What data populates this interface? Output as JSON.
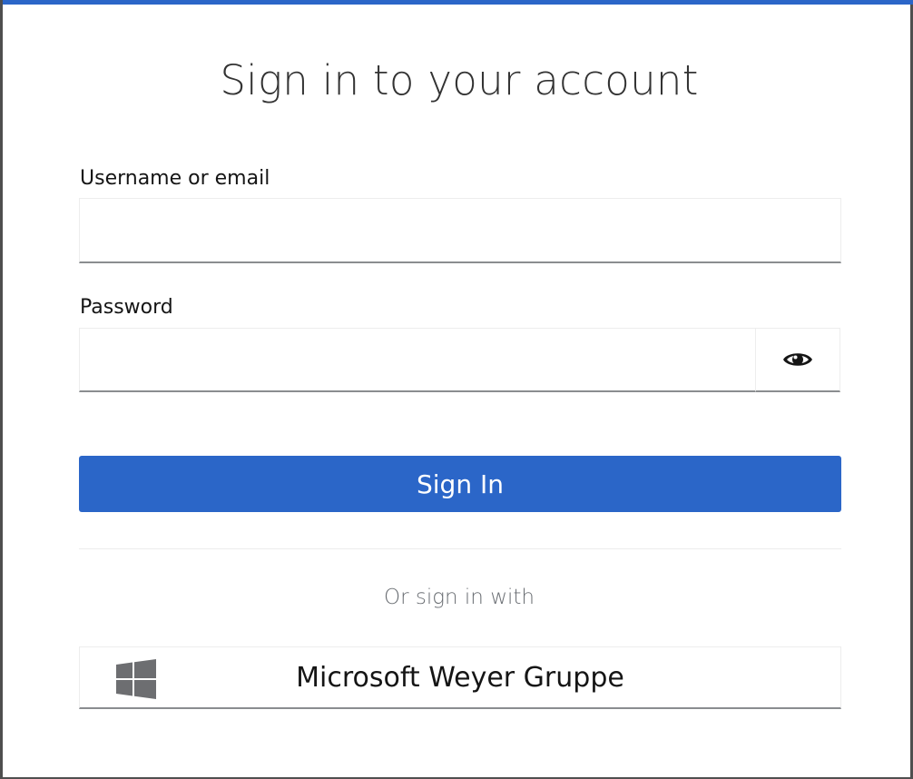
{
  "page": {
    "title": "Sign in to your account",
    "accent_color": "#2b66c8"
  },
  "form": {
    "username_label": "Username or email",
    "username_value": "",
    "password_label": "Password",
    "password_value": "",
    "show_password_icon": "eye-icon",
    "submit_label": "Sign In"
  },
  "social": {
    "divider_text": "Or sign in with",
    "providers": [
      {
        "label": "Microsoft Weyer Gruppe",
        "icon": "windows-icon"
      }
    ]
  }
}
